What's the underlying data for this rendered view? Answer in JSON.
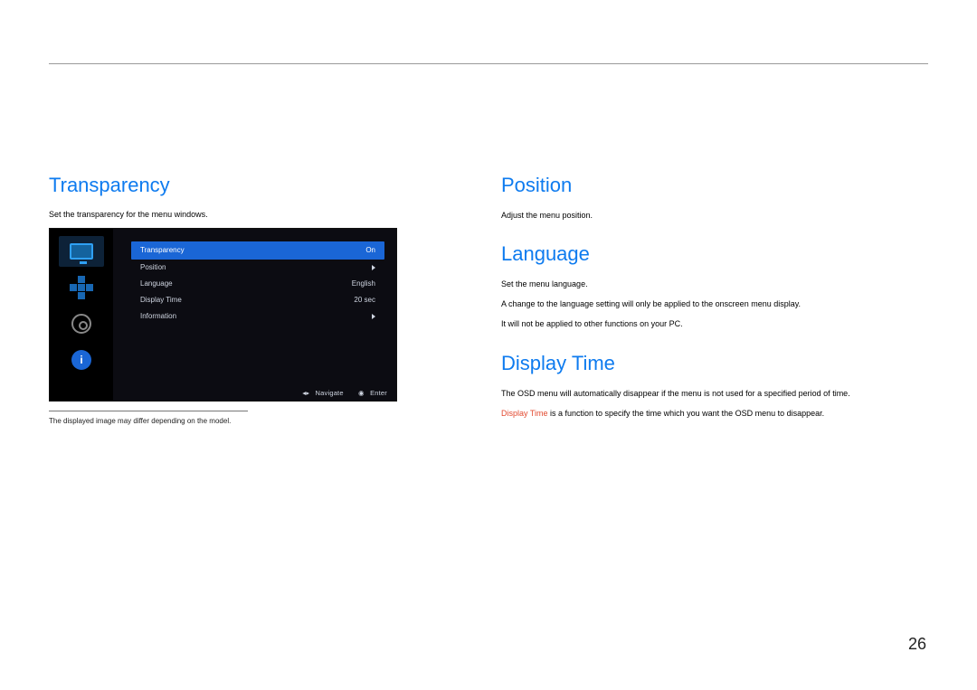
{
  "page_number": "26",
  "left": {
    "transparency": {
      "heading": "Transparency",
      "desc": "Set the transparency for the menu windows.",
      "footnote": "The displayed image may differ depending on the model."
    }
  },
  "right": {
    "position": {
      "heading": "Position",
      "desc": "Adjust the menu position."
    },
    "language": {
      "heading": "Language",
      "desc_line1": "Set the menu language.",
      "note1": "A change to the language setting will only be applied to the onscreen menu display.",
      "note2": "It will not be applied to other functions on your PC."
    },
    "display_time": {
      "heading": "Display Time",
      "desc": "The OSD menu will automatically disappear if the menu is not used for a specified period of time.",
      "desc2_prefix_hl": "Display Time",
      "desc2_suffix": " is a function to specify the time which you want the OSD menu to disappear."
    }
  },
  "osd": {
    "rows": [
      {
        "label": "Transparency",
        "value": "On"
      },
      {
        "label": "Position",
        "value": ""
      },
      {
        "label": "Language",
        "value": "English"
      },
      {
        "label": "Display Time",
        "value": "20 sec"
      },
      {
        "label": "Information",
        "value": ""
      }
    ],
    "footer": {
      "nav": "Navigate",
      "enter": "Enter"
    },
    "icons": {
      "monitor": "monitor-icon",
      "dpad": "dpad-icon",
      "gear": "gear-icon",
      "info": "info-icon"
    }
  }
}
